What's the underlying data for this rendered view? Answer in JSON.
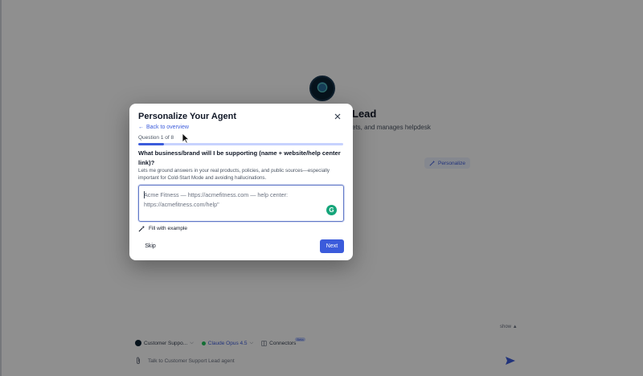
{
  "background": {
    "agent_name_visible": "Lead",
    "agent_desc_visible": "ets, and manages helpdesk",
    "personalize_label": "Personalize",
    "show_label": "show",
    "model_picker": {
      "agent_label": "Customer Suppo...",
      "model_label": "Claude Opus 4.5",
      "connectors_label": "Connectors",
      "connectors_badge": "Beta"
    },
    "composer_placeholder": "Talk to Customer Support Lead agent"
  },
  "modal": {
    "title": "Personalize Your Agent",
    "back_label": "Back to overview",
    "step_label": "Question 1 of 8",
    "progress_fraction": 0.125,
    "question": "What business/brand will I be supporting (name + website/help center link)?",
    "hint": "Lets me ground answers in your real products, policies, and public sources—especially important for Cold-Start Mode and avoiding hallucinations.",
    "answer_placeholder": "Acme Fitness — https://acmefitness.com — help center: https://acmefitness.com/help\"",
    "answer_value": "",
    "fill_example_label": "Fill with example",
    "skip_label": "Skip",
    "next_label": "Next"
  },
  "colors": {
    "accent": "#3b5bdb",
    "progress_track": "#c7d2fe",
    "overlay": "rgba(0,0,0,0.44)"
  },
  "icons": {
    "close": "close-icon",
    "back": "arrow-left-icon",
    "fill": "magic-wand-icon",
    "grammarly": "grammarly-icon",
    "send": "send-icon",
    "attach": "paperclip-icon"
  }
}
